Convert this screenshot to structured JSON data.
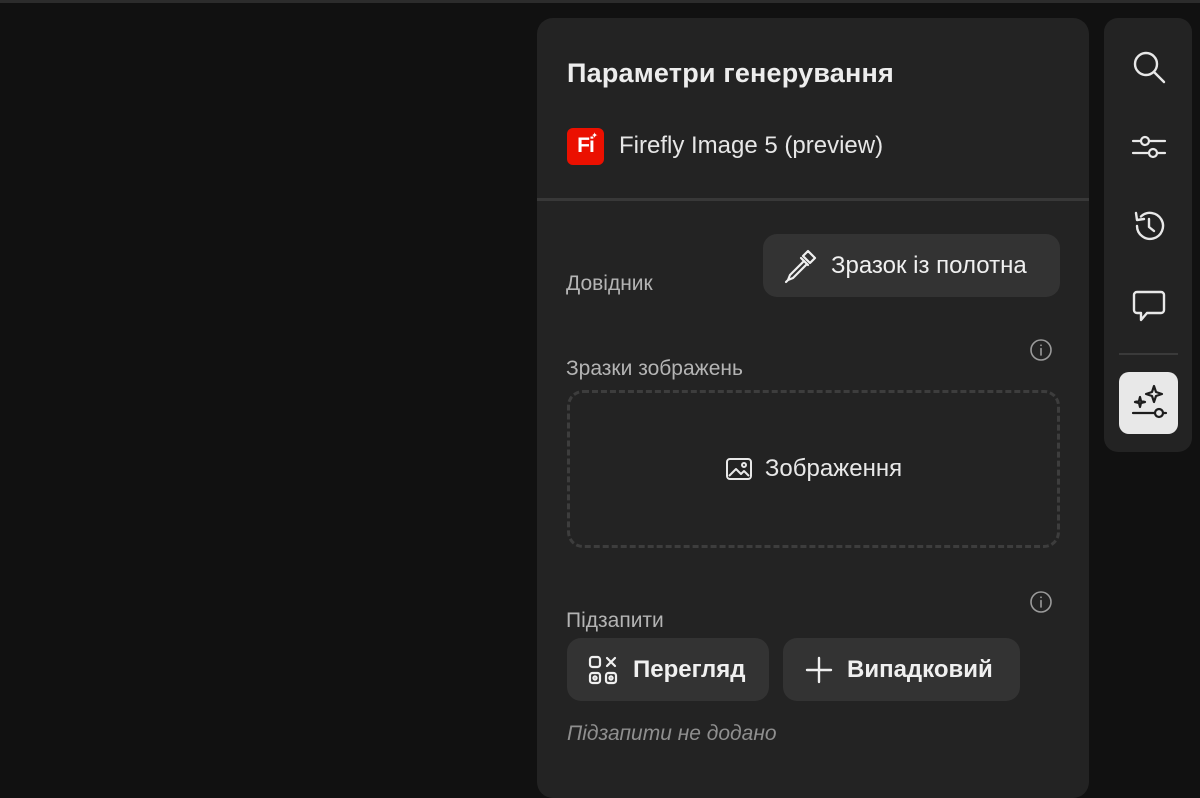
{
  "panel": {
    "title": "Параметри генерування",
    "model": {
      "logo_text": "Fi",
      "name": "Firefly Image 5 (preview)"
    },
    "reference": {
      "label": "Довідник",
      "sample_button_label": "Зразок із полотна"
    },
    "image_samples": {
      "label": "Зразки зображень",
      "dropzone_label": "Зображення"
    },
    "subprompts": {
      "label": "Підзапити",
      "view_button_label": "Перегляд",
      "random_button_label": "Випадковий",
      "empty_note": "Підзапити не додано"
    }
  },
  "rail": {
    "items": [
      {
        "icon": "search-icon"
      },
      {
        "icon": "adjustments-icon"
      },
      {
        "icon": "history-icon"
      },
      {
        "icon": "comment-icon"
      },
      {
        "icon": "generative-settings-icon",
        "active": true
      }
    ]
  },
  "colors": {
    "background": "#111111",
    "panel": "#232323",
    "button": "#333333",
    "brand_red": "#eb1000",
    "active_rail": "#e8e8e8"
  }
}
